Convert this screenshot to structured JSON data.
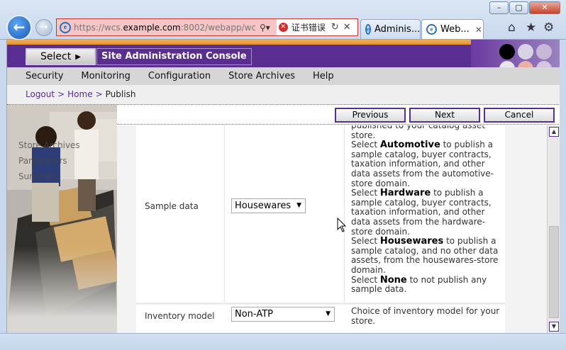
{
  "browser": {
    "window_buttons": [
      "–",
      "▢",
      "✕"
    ],
    "address": {
      "url_prefix": "https://wcs.",
      "url_domain": "example.com",
      "url_suffix": ":8002/webapp/wcs",
      "cert_error": "证书错误"
    },
    "tabs": [
      {
        "label": "Adminis..."
      },
      {
        "label": "Web..."
      }
    ]
  },
  "banner": {
    "select_label": "Select",
    "site_title": "Site Administration Console"
  },
  "menu": [
    "Security",
    "Monitoring",
    "Configuration",
    "Store Archives",
    "Help"
  ],
  "breadcrumb": {
    "logout": "Logout",
    "sep": ">",
    "home": "Home",
    "current": "Publish"
  },
  "left_nav": [
    "Store Archives",
    "Parameters",
    "Summary"
  ],
  "wizard_buttons": {
    "previous": "Previous",
    "next": "Next",
    "cancel": "Cancel"
  },
  "rows": [
    {
      "label": "Sample data",
      "value": "Housewares",
      "desc": {
        "intro": "published to your catalog asset store.",
        "select": "Select",
        "automotive": "Automotive",
        "automotive_text": "to publish a sample catalog, buyer contracts, taxation information, and other data assets from the automotive-store domain.",
        "hardware": "Hardware",
        "hardware_text": "to publish a sample catalog, buyer contracts, taxation information, and other data assets from the hardware-store domain.",
        "housewares": "Housewares",
        "housewares_text": "to publish a sample catalog, and no other data assets, from the housewares-store domain.",
        "none": "None",
        "none_text": "to not publish any sample data."
      }
    },
    {
      "label": "Inventory model",
      "value": "Non-ATP",
      "desc_text": "Choice of inventory model for your store."
    }
  ],
  "colors": {
    "brand_purple": "#5a2d91",
    "accent_orange": "#e8912a",
    "menubar_gray": "#d6d6d6"
  }
}
